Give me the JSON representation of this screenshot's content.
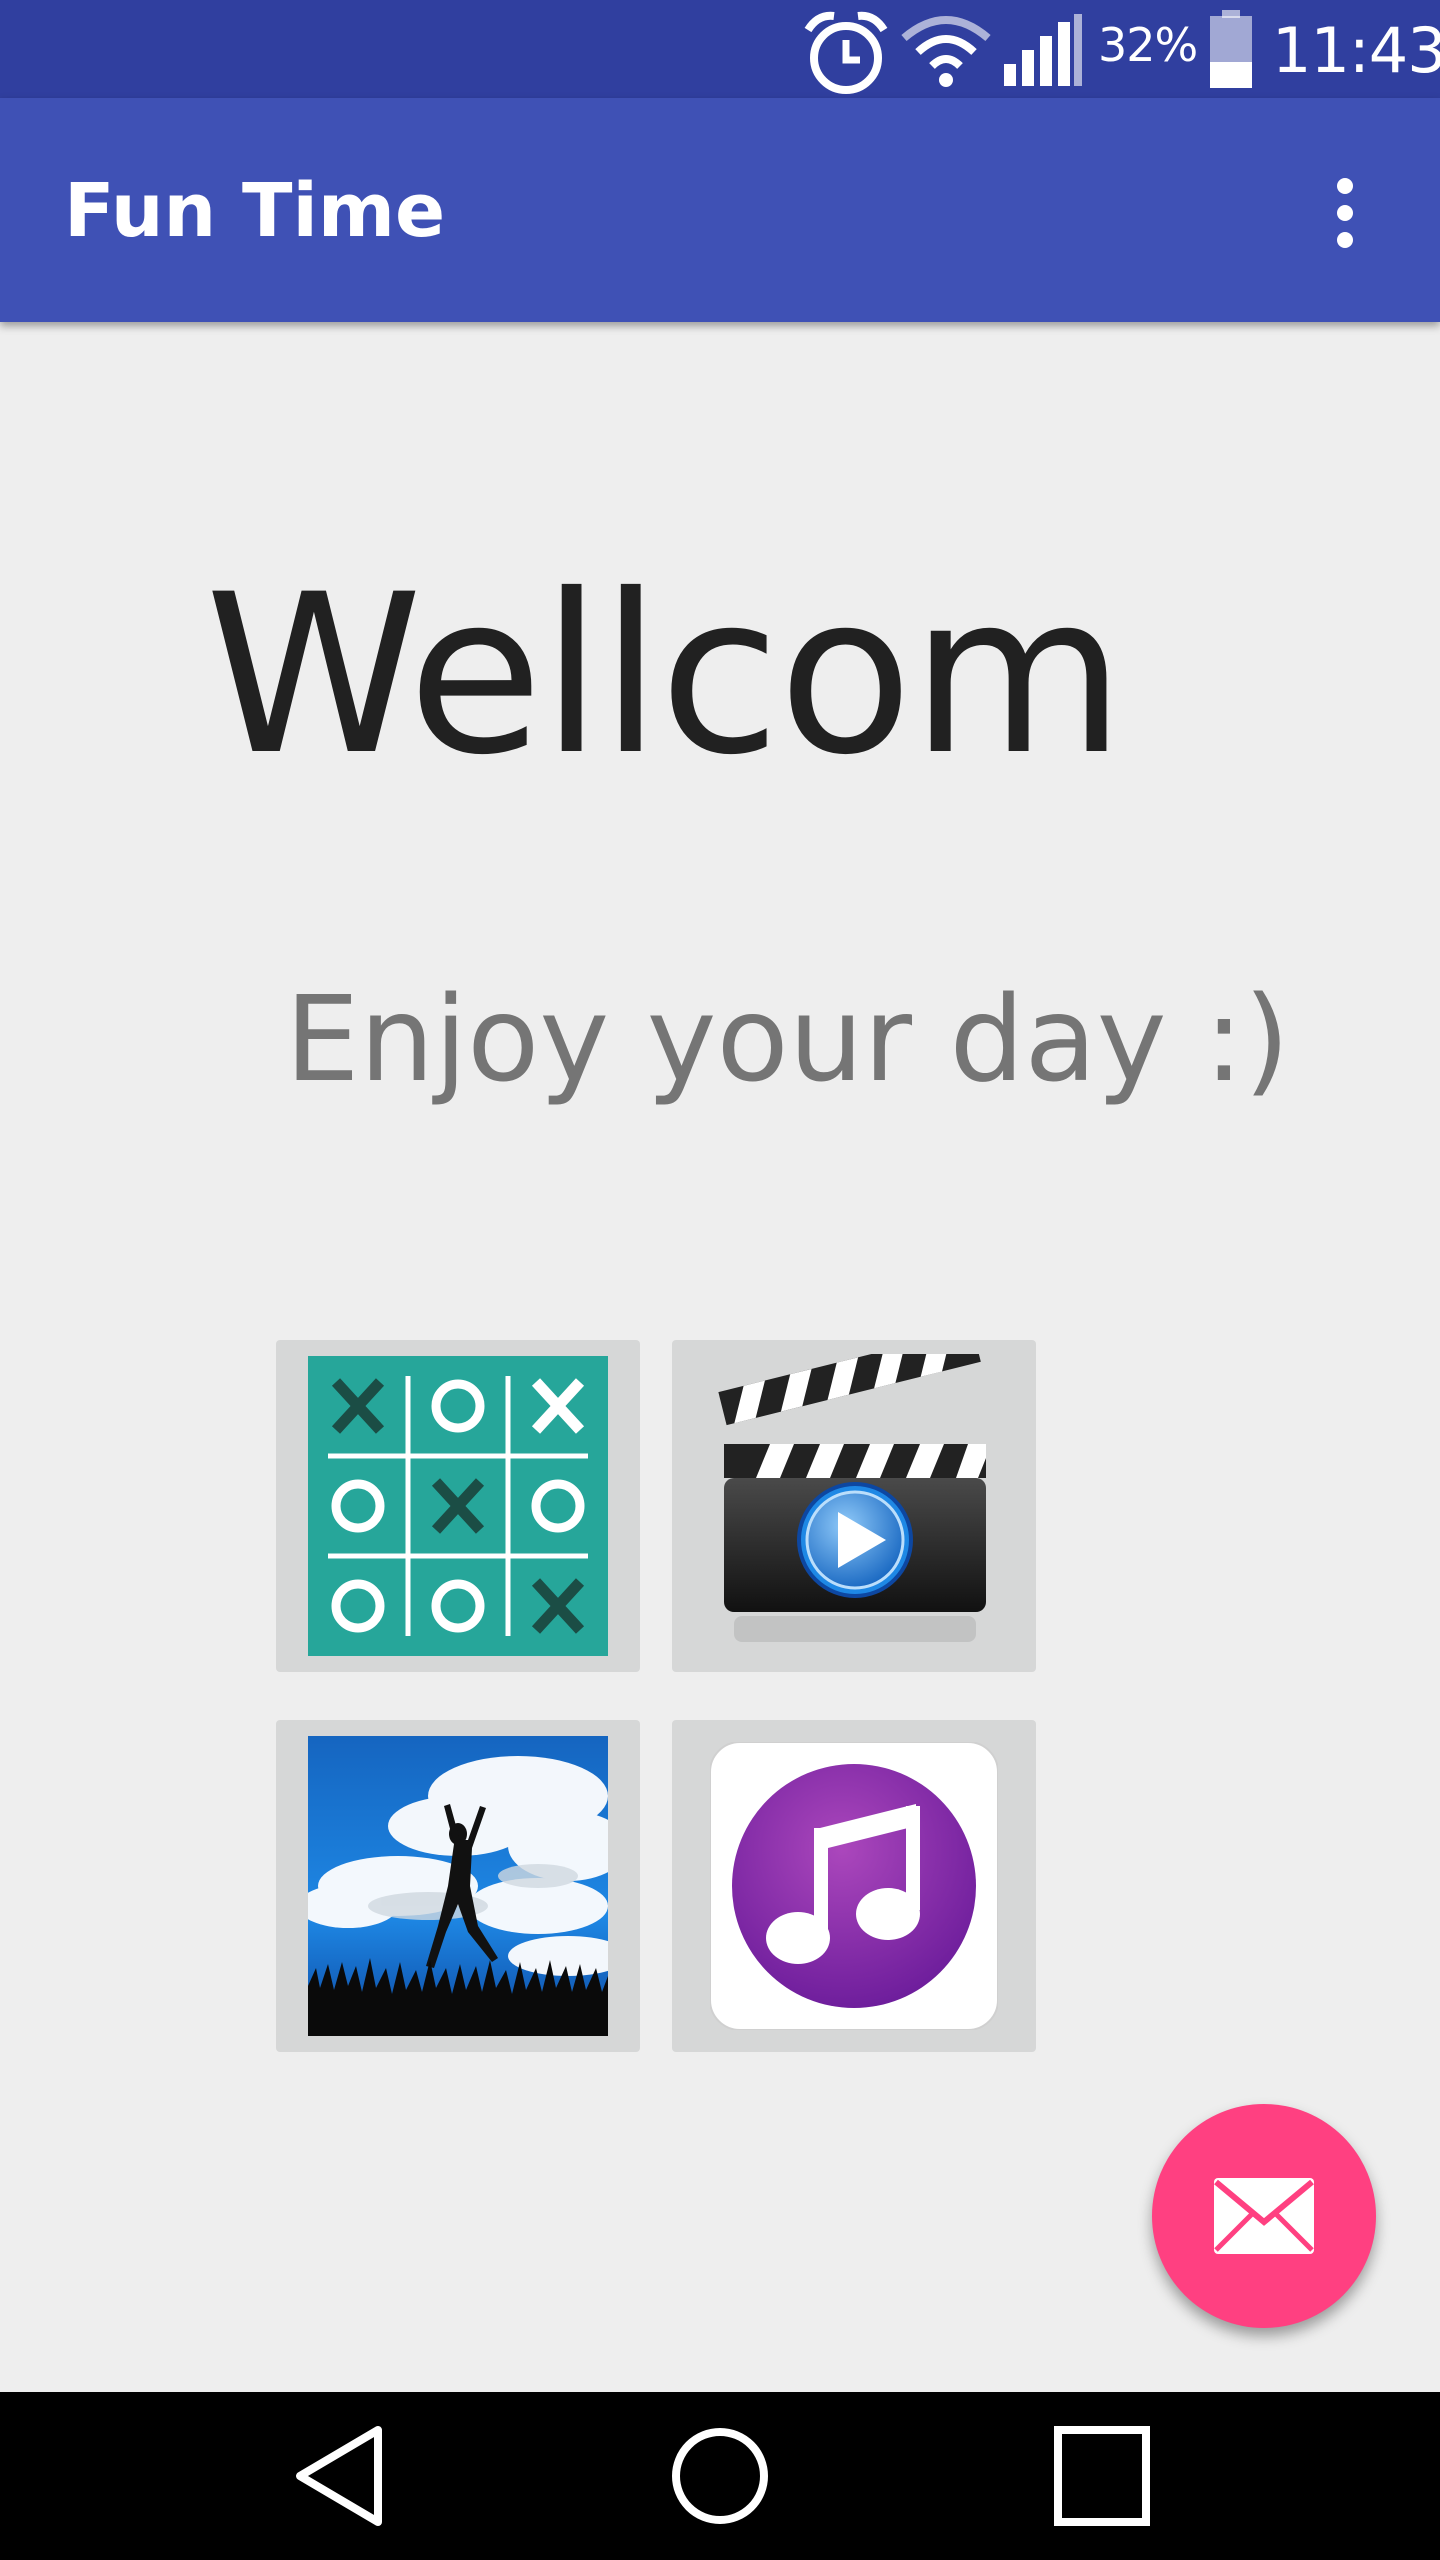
{
  "status_bar": {
    "battery_percent": "32%",
    "battery_level": 0.32,
    "time": "11:43",
    "icons": [
      "alarm-icon",
      "wifi-icon",
      "signal-icon",
      "battery-icon"
    ]
  },
  "app_bar": {
    "title": "Fun Time",
    "menu_icon": "overflow-menu-icon"
  },
  "main": {
    "heading": "Wellcom",
    "subheading": "Enjoy your day :)",
    "tiles": [
      {
        "name": "tic-tac-toe",
        "icon": "tic-tac-toe-icon",
        "board": [
          "X",
          "O",
          "X",
          "O",
          "X",
          "O",
          "O",
          "O",
          "X"
        ]
      },
      {
        "name": "video",
        "icon": "clapperboard-play-icon"
      },
      {
        "name": "dancing-photo",
        "icon": "dancing-silhouette-photo"
      },
      {
        "name": "music",
        "icon": "music-note-icon"
      }
    ]
  },
  "fab": {
    "icon": "envelope-icon"
  },
  "nav_bar": {
    "icons": [
      "back-icon",
      "home-icon",
      "recents-icon"
    ]
  },
  "colors": {
    "status_bar": "#303f9f",
    "app_bar": "#3f51b5",
    "background": "#eeeeee",
    "fab": "#ff4081",
    "ttt_board": "#26a69a",
    "music_purple": "#7b1fa2"
  }
}
